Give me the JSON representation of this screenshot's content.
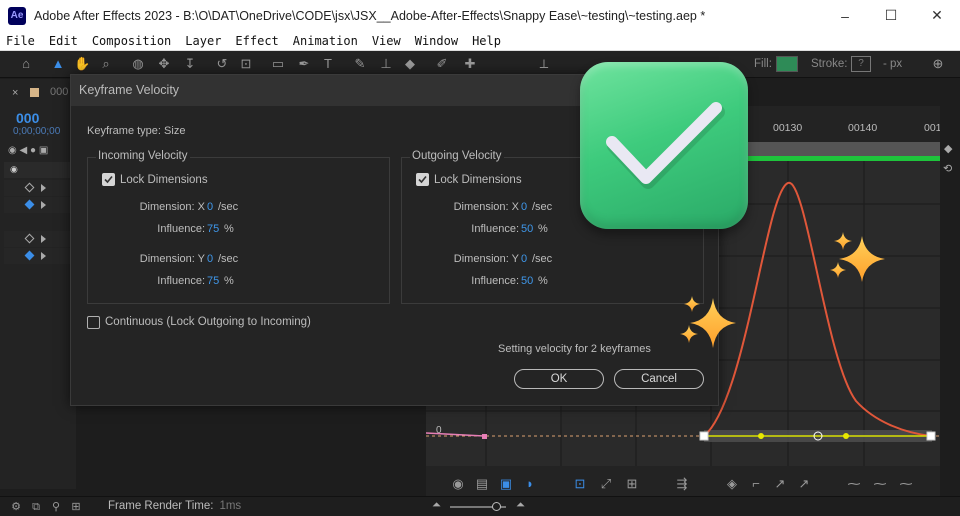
{
  "window": {
    "app_badge": "Ae",
    "title": "Adobe After Effects 2023 - B:\\O\\DAT\\OneDrive\\CODE\\jsx\\JSX__Adobe-After-Effects\\Snappy Ease\\~testing\\~testing.aep *",
    "minimize": "–",
    "maximize": "☐",
    "close": "✕"
  },
  "menu": [
    "File",
    "Edit",
    "Composition",
    "Layer",
    "Effect",
    "Animation",
    "View",
    "Window",
    "Help"
  ],
  "toolbar": {
    "fill_label": "Fill:",
    "fill_color": "#2e8b57",
    "stroke_label": "Stroke:",
    "stroke_value": "?",
    "px_label": "- px"
  },
  "timeline": {
    "panel_close": "×",
    "comp_number": "000",
    "timecode": "000",
    "timecode_sub": "0;00;00;00"
  },
  "ruler": {
    "ticks": [
      "00130",
      "00140",
      "001"
    ]
  },
  "graph": {
    "zero_label": "0"
  },
  "status": {
    "frame_render_label": "Frame Render Time:",
    "frame_render_value": "1ms"
  },
  "dialog": {
    "title": "Keyframe Velocity",
    "keyframe_type": "Keyframe type: Size",
    "incoming": {
      "title": "Incoming Velocity",
      "lock_label": "Lock Dimensions",
      "lock_checked": true,
      "dim_x_label": "Dimension: X",
      "dim_x_value": "0",
      "dim_x_unit": "/sec",
      "infl_x_label": "Influence:",
      "infl_x_value": "75",
      "infl_x_unit": "%",
      "dim_y_label": "Dimension: Y",
      "dim_y_value": "0",
      "dim_y_unit": "/sec",
      "infl_y_label": "Influence:",
      "infl_y_value": "75",
      "infl_y_unit": "%"
    },
    "outgoing": {
      "title": "Outgoing Velocity",
      "lock_label": "Lock Dimensions",
      "lock_checked": true,
      "dim_x_label": "Dimension: X",
      "dim_x_value": "0",
      "dim_x_unit": "/sec",
      "infl_x_label": "Influence:",
      "infl_x_value": "50",
      "infl_x_unit": "%",
      "dim_y_label": "Dimension: Y",
      "dim_y_value": "0",
      "dim_y_unit": "/sec",
      "infl_y_label": "Influence:",
      "infl_y_value": "50",
      "infl_y_unit": "%"
    },
    "continuous_label": "Continuous (Lock Outgoing to Incoming)",
    "continuous_checked": false,
    "setting_text": "Setting velocity for 2 keyframes",
    "ok_label": "OK",
    "cancel_label": "Cancel"
  },
  "colors": {
    "accent_blue": "#3f97ea",
    "curve": "#e0573a",
    "badge_green": "#3ecb7d",
    "sparkle": "#ffb238"
  }
}
